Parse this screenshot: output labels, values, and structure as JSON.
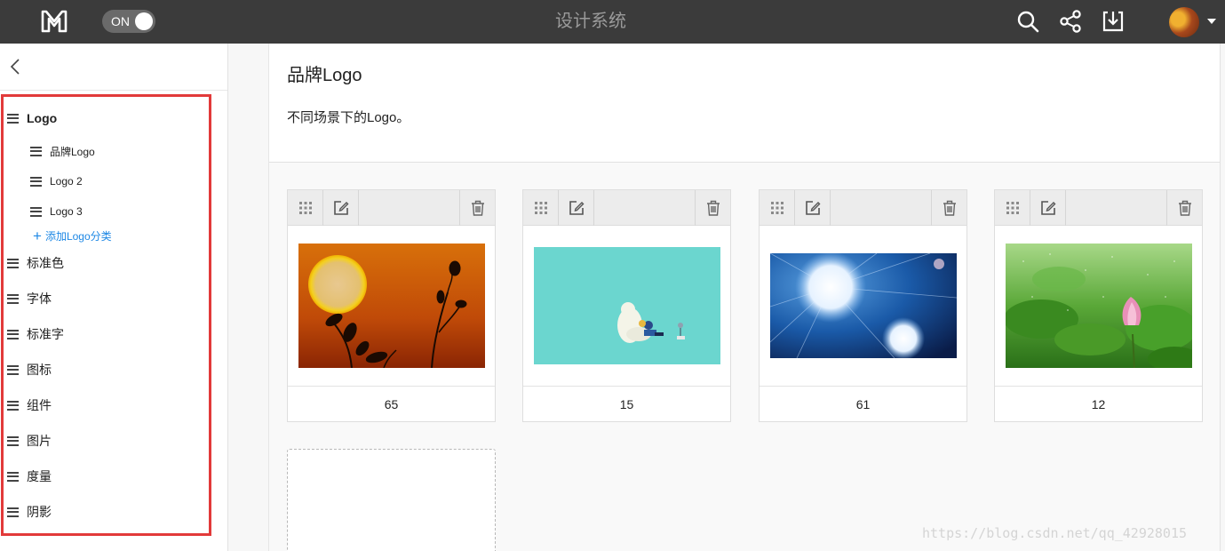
{
  "topbar": {
    "toggle_label": "ON",
    "app_title": "设计系统"
  },
  "sidebar": {
    "items": [
      {
        "label": "Logo",
        "level": "top",
        "selected": true
      },
      {
        "label": "品牌Logo",
        "level": "sub"
      },
      {
        "label": "Logo 2",
        "level": "sub"
      },
      {
        "label": "Logo 3",
        "level": "sub"
      },
      {
        "label": "标准色",
        "level": "top"
      },
      {
        "label": "字体",
        "level": "top"
      },
      {
        "label": "标准字",
        "level": "top"
      },
      {
        "label": "图标",
        "level": "top"
      },
      {
        "label": "组件",
        "level": "top"
      },
      {
        "label": "图片",
        "level": "top"
      },
      {
        "label": "度量",
        "level": "top"
      },
      {
        "label": "阴影",
        "level": "top"
      }
    ],
    "add_category_label": "添加Logo分类"
  },
  "content": {
    "title": "品牌Logo",
    "description": "不同场景下的Logo。"
  },
  "cards": [
    {
      "caption": "65",
      "image": "sunset-silhouette"
    },
    {
      "caption": "15",
      "image": "teal-illustration"
    },
    {
      "caption": "61",
      "image": "blue-stars"
    },
    {
      "caption": "12",
      "image": "lotus-rain"
    }
  ],
  "watermark": "https://blog.csdn.net/qq_42928015",
  "colors": {
    "topbar": "#3b3b3b",
    "highlight_border": "#e23a3a",
    "link_blue": "#1e88e5"
  }
}
